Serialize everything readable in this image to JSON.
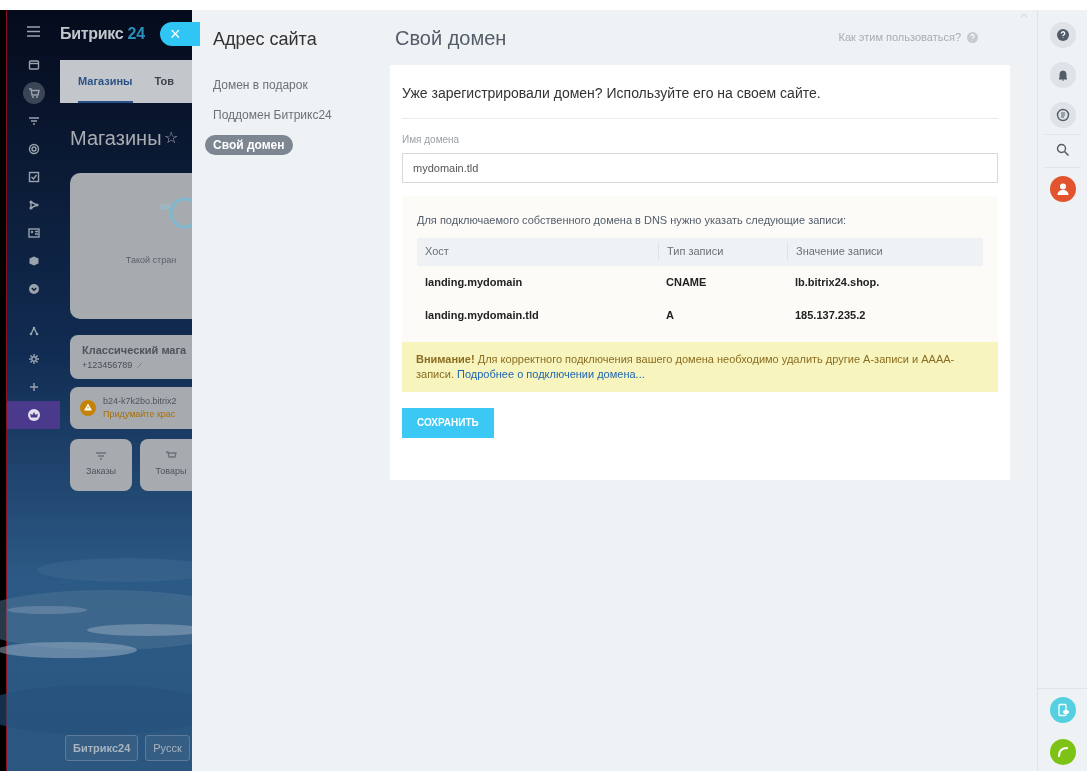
{
  "portal": {
    "logo": "Битрикс",
    "logo_number": "24",
    "nav_items": [
      {
        "selected": false,
        "promo": false
      },
      {
        "selected": true,
        "promo": false
      },
      {
        "selected": false,
        "promo": false
      },
      {
        "selected": false,
        "promo": false
      },
      {
        "selected": false,
        "promo": false
      },
      {
        "selected": false,
        "promo": false
      },
      {
        "selected": false,
        "promo": false
      },
      {
        "selected": false,
        "promo": false
      },
      {
        "selected": false,
        "promo": false
      },
      {
        "selected": false,
        "promo": false
      },
      {
        "selected": false,
        "promo": false
      },
      {
        "selected": false,
        "promo": false
      },
      {
        "selected": false,
        "promo": true
      }
    ],
    "tabs": [
      {
        "label": "Магазины",
        "selected": true
      },
      {
        "label": "Тов",
        "selected": false
      }
    ],
    "page_title": "Магазины",
    "star": "☆",
    "preview_caption": "Такой стран",
    "shop": {
      "name": "Классический мага",
      "phone": "+123456789"
    },
    "domain_notice": {
      "domain": "b24-k7k2bo.bitrix2",
      "hint": "Придумайте крас"
    },
    "tiles": [
      "Заказы",
      "Товары"
    ],
    "footer": [
      "Битрикс24",
      "Русск"
    ]
  },
  "close_button": "×",
  "slider": {
    "title": "Адрес сайта",
    "menu": [
      {
        "label": "Домен в подарок",
        "selected": false
      },
      {
        "label": "Поддомен Битрикс24",
        "selected": false
      },
      {
        "label": "Свой домен",
        "selected": true
      }
    ],
    "heading": "Свой домен",
    "help_link": "Как этим пользоваться?",
    "intro": "Уже зарегистрировали домен? Используйте его на своем сайте.",
    "field": {
      "label": "Имя домена",
      "value": "mydomain.tld"
    },
    "dns": {
      "text": "Для подключаемого собственного домена в DNS нужно указать следующие записи:",
      "columns": [
        "Хост",
        "Тип записи",
        "Значение записи"
      ],
      "rows": [
        [
          "landing.mydomain",
          "CNAME",
          "lb.bitrix24.shop."
        ],
        [
          "landing.mydomain.tld",
          "A",
          "185.137.235.2"
        ]
      ]
    },
    "warning": {
      "text": "**Внимание!** Для корректного подключения вашего домена необходимо удалить другие А-записи и АААА-записи.",
      "link": "Подробнее о подключении домена..."
    },
    "save_button": "СОХРАНИТЬ"
  }
}
